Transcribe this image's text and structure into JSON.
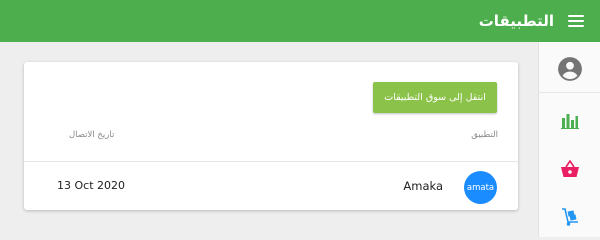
{
  "header": {
    "title": "التطبيقات",
    "menu_icon": "hamburger-menu-icon",
    "background": "#4cae4c"
  },
  "sidebar": {
    "items": [
      {
        "icon": "account-circle-icon",
        "color": "#757575"
      },
      {
        "icon": "bar-chart-icon",
        "color": "#4caf50"
      },
      {
        "icon": "shopping-basket-icon",
        "color": "#e91e63"
      },
      {
        "icon": "hand-truck-icon",
        "color": "#2196f3"
      }
    ]
  },
  "card": {
    "store_button_label": "انتقل إلى سوق التطبيقات",
    "store_button_color": "#8bc34a",
    "columns": {
      "app": "التطبيق",
      "connection_date": "تاريخ الاتصال"
    },
    "rows": [
      {
        "logo_text": "amata",
        "logo_color": "#1a8cff",
        "name": "Amaka",
        "date": "13 Oct 2020"
      }
    ]
  }
}
